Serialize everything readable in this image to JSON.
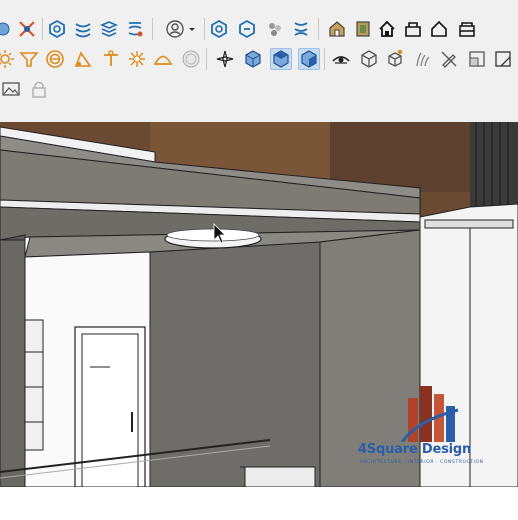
{
  "toolbar": {
    "row1": [
      {
        "name": "orbit-icon"
      },
      {
        "name": "zoom-extents-icon"
      },
      {
        "name": "section-plane-icon"
      },
      {
        "name": "layers-icon"
      },
      {
        "name": "materials-icon"
      },
      {
        "name": "styles-icon"
      },
      {
        "name": "user-icon"
      },
      {
        "name": "dropdown-arrow-icon"
      },
      {
        "name": "section-fill-icon"
      },
      {
        "name": "section-cut-icon"
      },
      {
        "name": "components-icon"
      },
      {
        "name": "outliner-icon"
      },
      {
        "name": "warehouse-icon"
      },
      {
        "name": "extension-icon"
      },
      {
        "name": "house-icon"
      },
      {
        "name": "house-front-icon"
      },
      {
        "name": "house-outline-icon"
      },
      {
        "name": "building-icon"
      }
    ],
    "row2": [
      {
        "name": "light-icon"
      },
      {
        "name": "funnel-icon"
      },
      {
        "name": "target-icon"
      },
      {
        "name": "triangle-ruler-icon"
      },
      {
        "name": "spotlight-icon"
      },
      {
        "name": "sun-icon"
      },
      {
        "name": "dome-icon"
      },
      {
        "name": "sphere-icon"
      },
      {
        "name": "compass-icon"
      },
      {
        "name": "view-iso-icon"
      },
      {
        "name": "view-top-icon"
      },
      {
        "name": "view-front-icon"
      },
      {
        "name": "eye-icon"
      },
      {
        "name": "box-icon"
      },
      {
        "name": "box-explode-icon"
      },
      {
        "name": "grass-icon"
      },
      {
        "name": "pencil-slash-icon"
      },
      {
        "name": "scale-icon"
      },
      {
        "name": "frame-icon"
      },
      {
        "name": "edit-icon"
      }
    ],
    "row3": [
      {
        "name": "picture-icon"
      },
      {
        "name": "lock-icon"
      }
    ]
  },
  "watermark": {
    "brand": "4Square Design",
    "tagline": "ARCHITECTURE · INTERIOR · CONSTRUCTION"
  }
}
